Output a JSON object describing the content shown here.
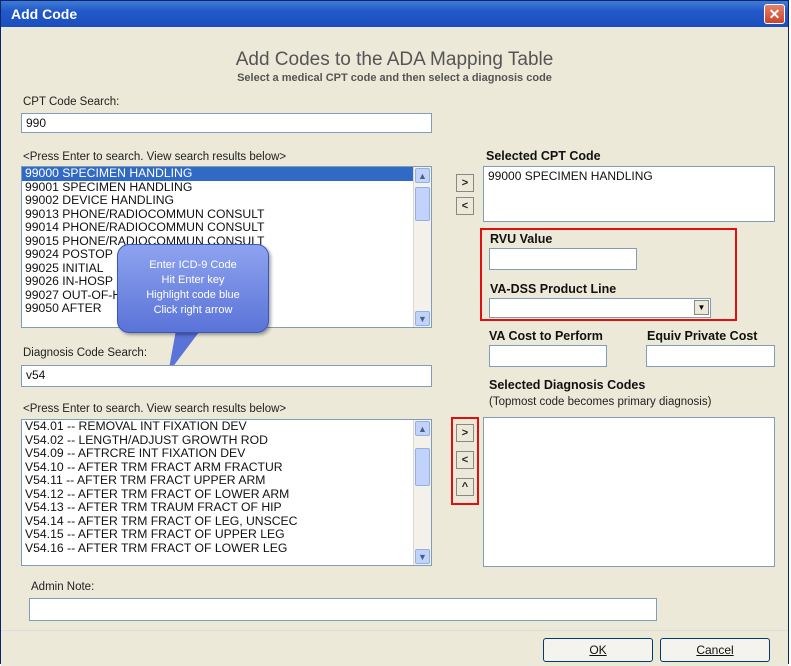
{
  "window": {
    "title": "Add Code",
    "close_glyph": "✕"
  },
  "header": {
    "title": "Add Codes to the ADA Mapping Table",
    "subtitle": "Select a medical CPT code and then select a diagnosis code"
  },
  "cpt": {
    "search_label": "CPT Code Search:",
    "search_value": "990",
    "hint": "<Press Enter to search.  View search results below>",
    "results": [
      "99000  SPECIMEN HANDLING",
      "99001  SPECIMEN HANDLING",
      "99002  DEVICE HANDLING",
      "99013  PHONE/RADIOCOMMUN CONSULT",
      "99014  PHONE/RADIOCOMMUN CONSULT",
      "99015  PHONE/RADIOCOMMUN CONSULT",
      "99024  POSTOP",
      "99025  INITIAL",
      "99026  IN-HOSP",
      "99027  OUT-OF-HOSP SERVICE",
      "99050  AFTER"
    ],
    "selected_index": 0
  },
  "callout": {
    "lines": [
      "Enter ICD-9 Code",
      "Hit Enter key",
      "Highlight code blue",
      "Click right arrow"
    ]
  },
  "selected_cpt": {
    "label": "Selected CPT Code",
    "value": "99000  SPECIMEN HANDLING"
  },
  "rvu": {
    "label": "RVU Value",
    "value": ""
  },
  "product_line": {
    "label": "VA-DSS Product Line",
    "value": ""
  },
  "costs": {
    "va_label": "VA Cost to Perform",
    "va_value": "",
    "private_label": "Equiv Private Cost",
    "private_value": ""
  },
  "diagnosis": {
    "search_label": "Diagnosis Code Search:",
    "search_value": "v54",
    "hint": "<Press Enter to search.  View search results below>",
    "results": [
      "V54.01 -- REMOVAL INT FIXATION DEV",
      "V54.02 -- LENGTH/ADJUST GROWTH ROD",
      "V54.09 -- AFTRCRE INT FIXATION DEV",
      "V54.10 -- AFTER TRM FRACT ARM FRACTUR",
      "V54.11 -- AFTER TRM FRACT UPPER ARM",
      "V54.12 -- AFTER TRM FRACT OF LOWER ARM",
      "V54.13 -- AFTER TRM TRAUM FRACT OF HIP",
      "V54.14 -- AFTER TRM FRACT OF LEG, UNSCEC",
      "V54.15 -- AFTER TRM FRACT OF UPPER LEG",
      "V54.16 -- AFTER TRM FRACT OF LOWER LEG"
    ]
  },
  "selected_dx": {
    "label": "Selected Diagnosis Codes",
    "note": "(Topmost code becomes primary diagnosis)"
  },
  "arrows": {
    "right": ">",
    "left": "<",
    "up": "^"
  },
  "admin": {
    "label": "Admin Note:",
    "value": ""
  },
  "buttons": {
    "ok": "OK",
    "cancel": "Cancel"
  },
  "colors": {
    "highlight": "#316ac5",
    "red_box": "#e01010",
    "title_bar": "#2258c7"
  }
}
